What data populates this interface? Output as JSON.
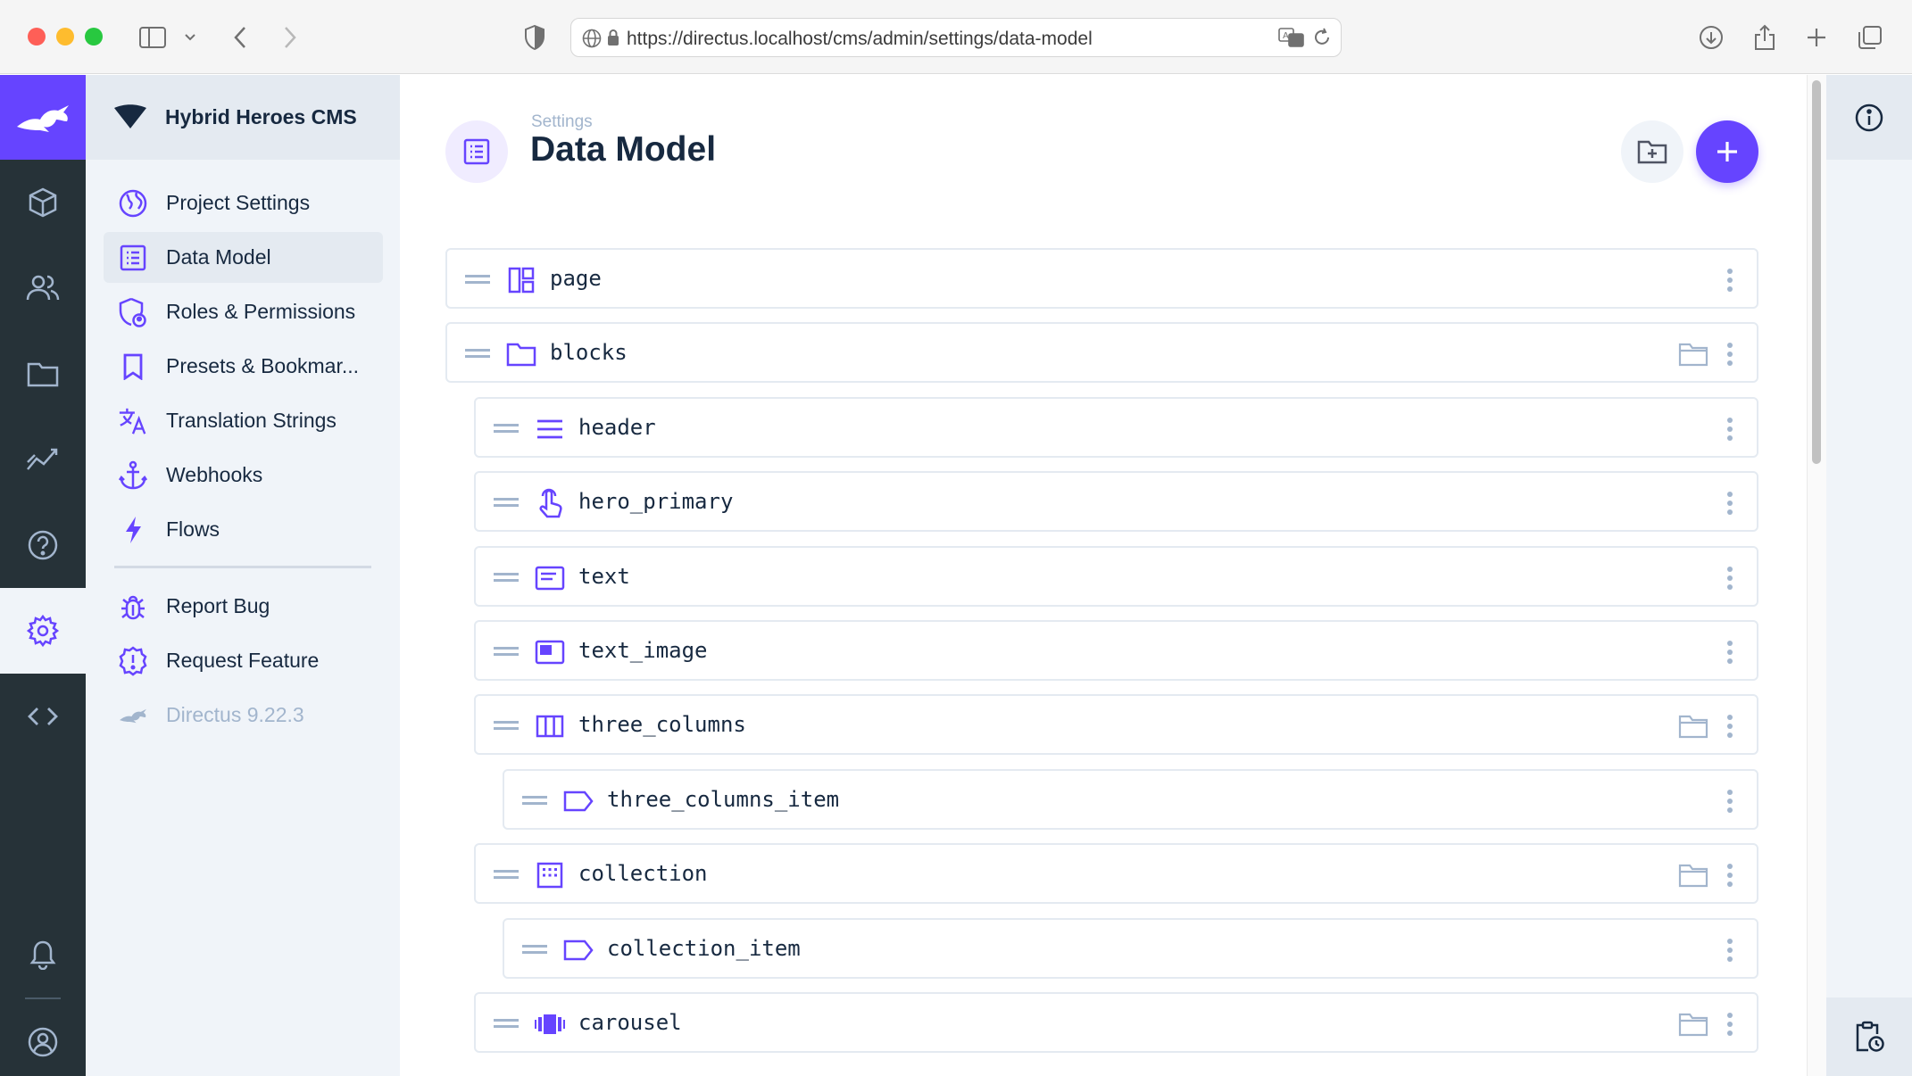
{
  "browser": {
    "url": "https://directus.localhost/cms/admin/settings/data-model"
  },
  "project": {
    "name": "Hybrid Heroes CMS"
  },
  "module_bar": {
    "items": [
      "content",
      "users",
      "files",
      "insights",
      "help",
      "settings",
      "extensions"
    ],
    "active": "settings"
  },
  "nav": {
    "items": [
      {
        "label": "Project Settings",
        "icon": "globe-icon"
      },
      {
        "label": "Data Model",
        "icon": "list-alt-icon",
        "active": true
      },
      {
        "label": "Roles & Permissions",
        "icon": "admin-shield-icon"
      },
      {
        "label": "Presets & Bookmar...",
        "icon": "bookmark-icon"
      },
      {
        "label": "Translation Strings",
        "icon": "translate-icon"
      },
      {
        "label": "Webhooks",
        "icon": "anchor-icon"
      },
      {
        "label": "Flows",
        "icon": "bolt-icon"
      }
    ],
    "secondary": [
      {
        "label": "Report Bug",
        "icon": "bug-icon"
      },
      {
        "label": "Request Feature",
        "icon": "feature-badge-icon"
      },
      {
        "label": "Directus 9.22.3",
        "icon": "directus-rabbit-icon"
      }
    ]
  },
  "header": {
    "breadcrumb": "Settings",
    "title": "Data Model"
  },
  "collections": [
    {
      "name": "page",
      "icon": "dashboard-icon",
      "level": 0,
      "folder": false
    },
    {
      "name": "blocks",
      "icon": "folder-icon",
      "level": 0,
      "folder": true
    },
    {
      "name": "header",
      "icon": "menu-lines-icon",
      "level": 1,
      "folder": false
    },
    {
      "name": "hero_primary",
      "icon": "touch-icon",
      "level": 1,
      "folder": false
    },
    {
      "name": "text",
      "icon": "text-card-icon",
      "level": 1,
      "folder": false
    },
    {
      "name": "text_image",
      "icon": "image-card-icon",
      "level": 1,
      "folder": false
    },
    {
      "name": "three_columns",
      "icon": "columns-icon",
      "level": 1,
      "folder": true
    },
    {
      "name": "three_columns_item",
      "icon": "label-icon",
      "level": 2,
      "folder": false
    },
    {
      "name": "collection",
      "icon": "grid-dots-icon",
      "level": 1,
      "folder": true
    },
    {
      "name": "collection_item",
      "icon": "label-icon",
      "level": 2,
      "folder": false
    },
    {
      "name": "carousel",
      "icon": "carousel-icon",
      "level": 1,
      "folder": true
    }
  ],
  "colors": {
    "primary": "#6644ff",
    "module_bar": "#263238",
    "nav_background": "#f0f4f9",
    "text": "#172940",
    "muted": "#a2b5cd"
  }
}
